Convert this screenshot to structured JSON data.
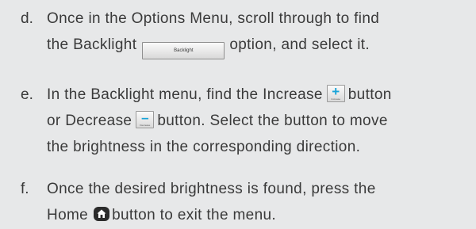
{
  "steps": [
    {
      "letter": "d.",
      "line1": "Once in the Options Menu, scroll through to find",
      "line2_before": "the Backlight",
      "button_label": "Backlight",
      "line2_after": "option, and select it."
    },
    {
      "letter": "e.",
      "line1_before": "In the Backlight menu, find the Increase",
      "increase_symbol": "+",
      "increase_caption": "Increase",
      "line1_after": "button",
      "line2_before": "or Decrease",
      "decrease_symbol": "–",
      "decrease_caption": "Decrease",
      "line2_after": "button. Select the button to move",
      "line3": "the brightness in the corresponding direction."
    },
    {
      "letter": "f.",
      "line1": "Once the desired brightness is found, press the",
      "line2_before": "Home",
      "line2_after": "button to exit the menu."
    }
  ],
  "icons": {
    "home": "home-icon"
  },
  "colors": {
    "background": "#e7e8e9",
    "text": "#3a3a3a",
    "accent": "#17a3d8",
    "home_icon": "#2b2b2b"
  }
}
